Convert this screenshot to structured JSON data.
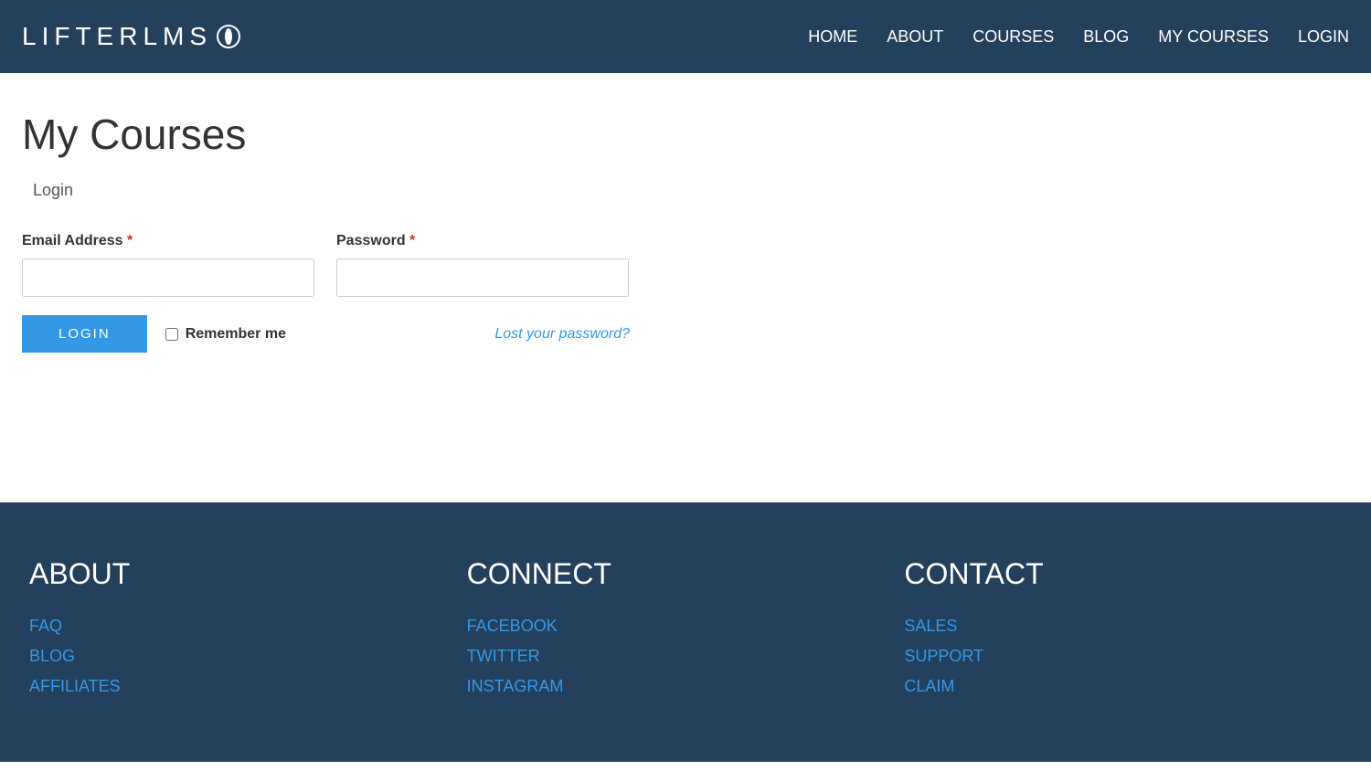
{
  "header": {
    "logo_text": "LIFTERLMS",
    "nav": [
      {
        "label": "HOME"
      },
      {
        "label": "ABOUT"
      },
      {
        "label": "COURSES"
      },
      {
        "label": "BLOG"
      },
      {
        "label": "MY COURSES"
      },
      {
        "label": "LOGIN"
      }
    ]
  },
  "main": {
    "page_title": "My Courses",
    "login_section_title": "Login",
    "email_label": "Email Address",
    "password_label": "Password",
    "required_mark": "*",
    "login_button": "LOGIN",
    "remember_label": "Remember me",
    "lost_password": "Lost your password?"
  },
  "footer": {
    "columns": [
      {
        "heading": "ABOUT",
        "links": [
          "FAQ",
          "BLOG",
          "AFFILIATES"
        ]
      },
      {
        "heading": "CONNECT",
        "links": [
          "FACEBOOK",
          "TWITTER",
          "INSTAGRAM"
        ]
      },
      {
        "heading": "CONTACT",
        "links": [
          "SALES",
          "SUPPORT",
          "CLAIM"
        ]
      }
    ]
  }
}
